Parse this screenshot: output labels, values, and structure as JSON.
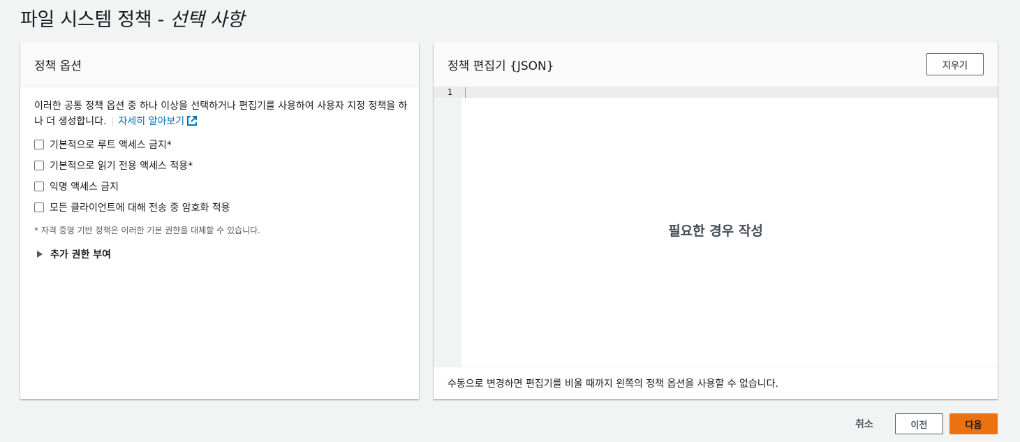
{
  "page": {
    "title_main": "파일 시스템 정책 - ",
    "title_italic": "선택 사항"
  },
  "policy_options": {
    "title": "정책 옵션",
    "description": "이러한 공통 정책 옵션 중 하나 이상을 선택하거나 편집기를 사용하여 사용자 지정 정책을 하나 더 생성합니다.",
    "learn_more": "자세히 알아보기",
    "checkboxes": [
      {
        "label": "기본적으로 루트 액세스 금지*",
        "checked": false
      },
      {
        "label": "기본적으로 읽기 전용 액세스 적용*",
        "checked": false
      },
      {
        "label": "익명 액세스 금지",
        "checked": false
      },
      {
        "label": "모든 클라이언트에 대해 전송 중 암호화 적용",
        "checked": false
      }
    ],
    "footnote": "* 자격 증명 기반 정책은 이러한 기본 권한을 대체할 수 있습니다.",
    "expander": "추가 권한 부여"
  },
  "editor": {
    "title": "정책 편집기 {JSON}",
    "clear_button": "지우기",
    "line_number": "1",
    "placeholder": "필요한 경우 작성",
    "note": "수동으로 변경하면 편집기를 비울 때까지 왼쪽의 정책 옵션을 사용할 수 없습니다."
  },
  "footer": {
    "cancel": "취소",
    "previous": "이전",
    "next": "다음"
  },
  "colors": {
    "primary_button": "#ec7211",
    "link": "#0073bb",
    "background": "#f2f3f3"
  }
}
